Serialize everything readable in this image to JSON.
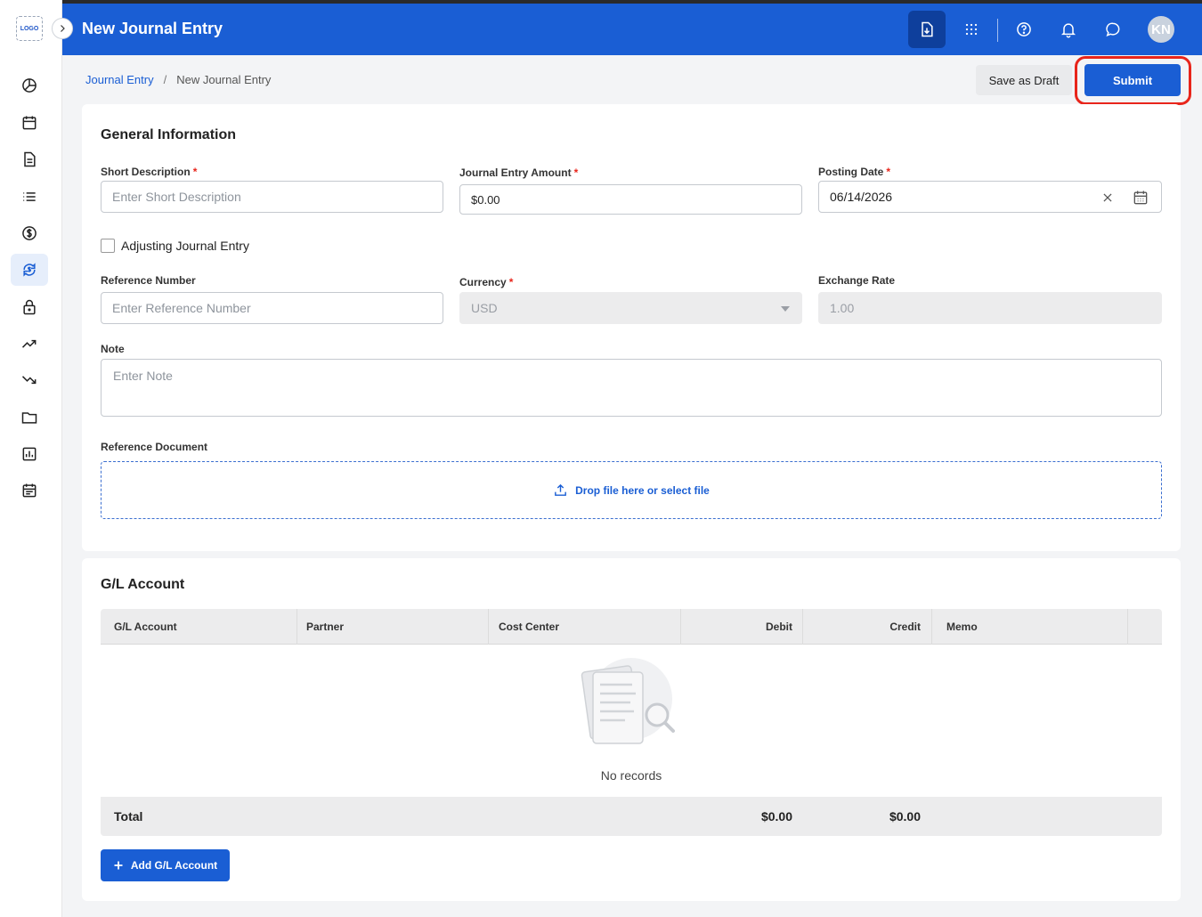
{
  "app": {
    "logo_text": "LOGO",
    "title": "New Journal Entry",
    "avatar_initials": "KN"
  },
  "colors": {
    "primary": "#1a5ed4",
    "highlight_ring": "#e8251b",
    "required": "#e8251b"
  },
  "rail": {
    "items": [
      {
        "icon": "pie-chart-icon"
      },
      {
        "icon": "calendar-icon"
      },
      {
        "icon": "document-icon"
      },
      {
        "icon": "list-icon"
      },
      {
        "icon": "dollar-icon"
      },
      {
        "icon": "currency-exchange-icon",
        "active": true
      },
      {
        "icon": "lock-icon"
      },
      {
        "icon": "trending-up-icon"
      },
      {
        "icon": "trending-down-icon"
      },
      {
        "icon": "folder-icon"
      },
      {
        "icon": "report-icon"
      },
      {
        "icon": "schedule-icon"
      }
    ]
  },
  "topbar": {
    "icons": [
      "document-download-icon",
      "apps-grid-icon",
      "help-icon",
      "bell-icon",
      "chat-icon"
    ]
  },
  "breadcrumb": {
    "parent": "Journal Entry",
    "separator": "/",
    "current": "New Journal Entry"
  },
  "actions": {
    "save_draft": "Save as Draft",
    "submit": "Submit"
  },
  "general": {
    "title": "General Information",
    "short_description": {
      "label": "Short Description",
      "placeholder": "Enter Short Description",
      "value": ""
    },
    "amount": {
      "label": "Journal Entry Amount",
      "value": "$0.00"
    },
    "posting_date": {
      "label": "Posting Date",
      "value": "06/14/2026"
    },
    "adjusting": {
      "label": "Adjusting Journal Entry",
      "checked": false
    },
    "reference_number": {
      "label": "Reference Number",
      "placeholder": "Enter Reference Number",
      "value": ""
    },
    "currency": {
      "label": "Currency",
      "value": "USD"
    },
    "exchange_rate": {
      "label": "Exchange Rate",
      "value": "1.00"
    },
    "note": {
      "label": "Note",
      "placeholder": "Enter Note",
      "value": ""
    },
    "reference_document": {
      "label": "Reference Document",
      "dropzone_text": "Drop file here or select file"
    }
  },
  "gl": {
    "title": "G/L Account",
    "columns": [
      "G/L Account",
      "Partner",
      "Cost Center",
      "Debit",
      "Credit",
      "Memo"
    ],
    "rows": [],
    "empty_text": "No records",
    "total_label": "Total",
    "total_debit": "$0.00",
    "total_credit": "$0.00",
    "add_button": "Add G/L Account"
  }
}
